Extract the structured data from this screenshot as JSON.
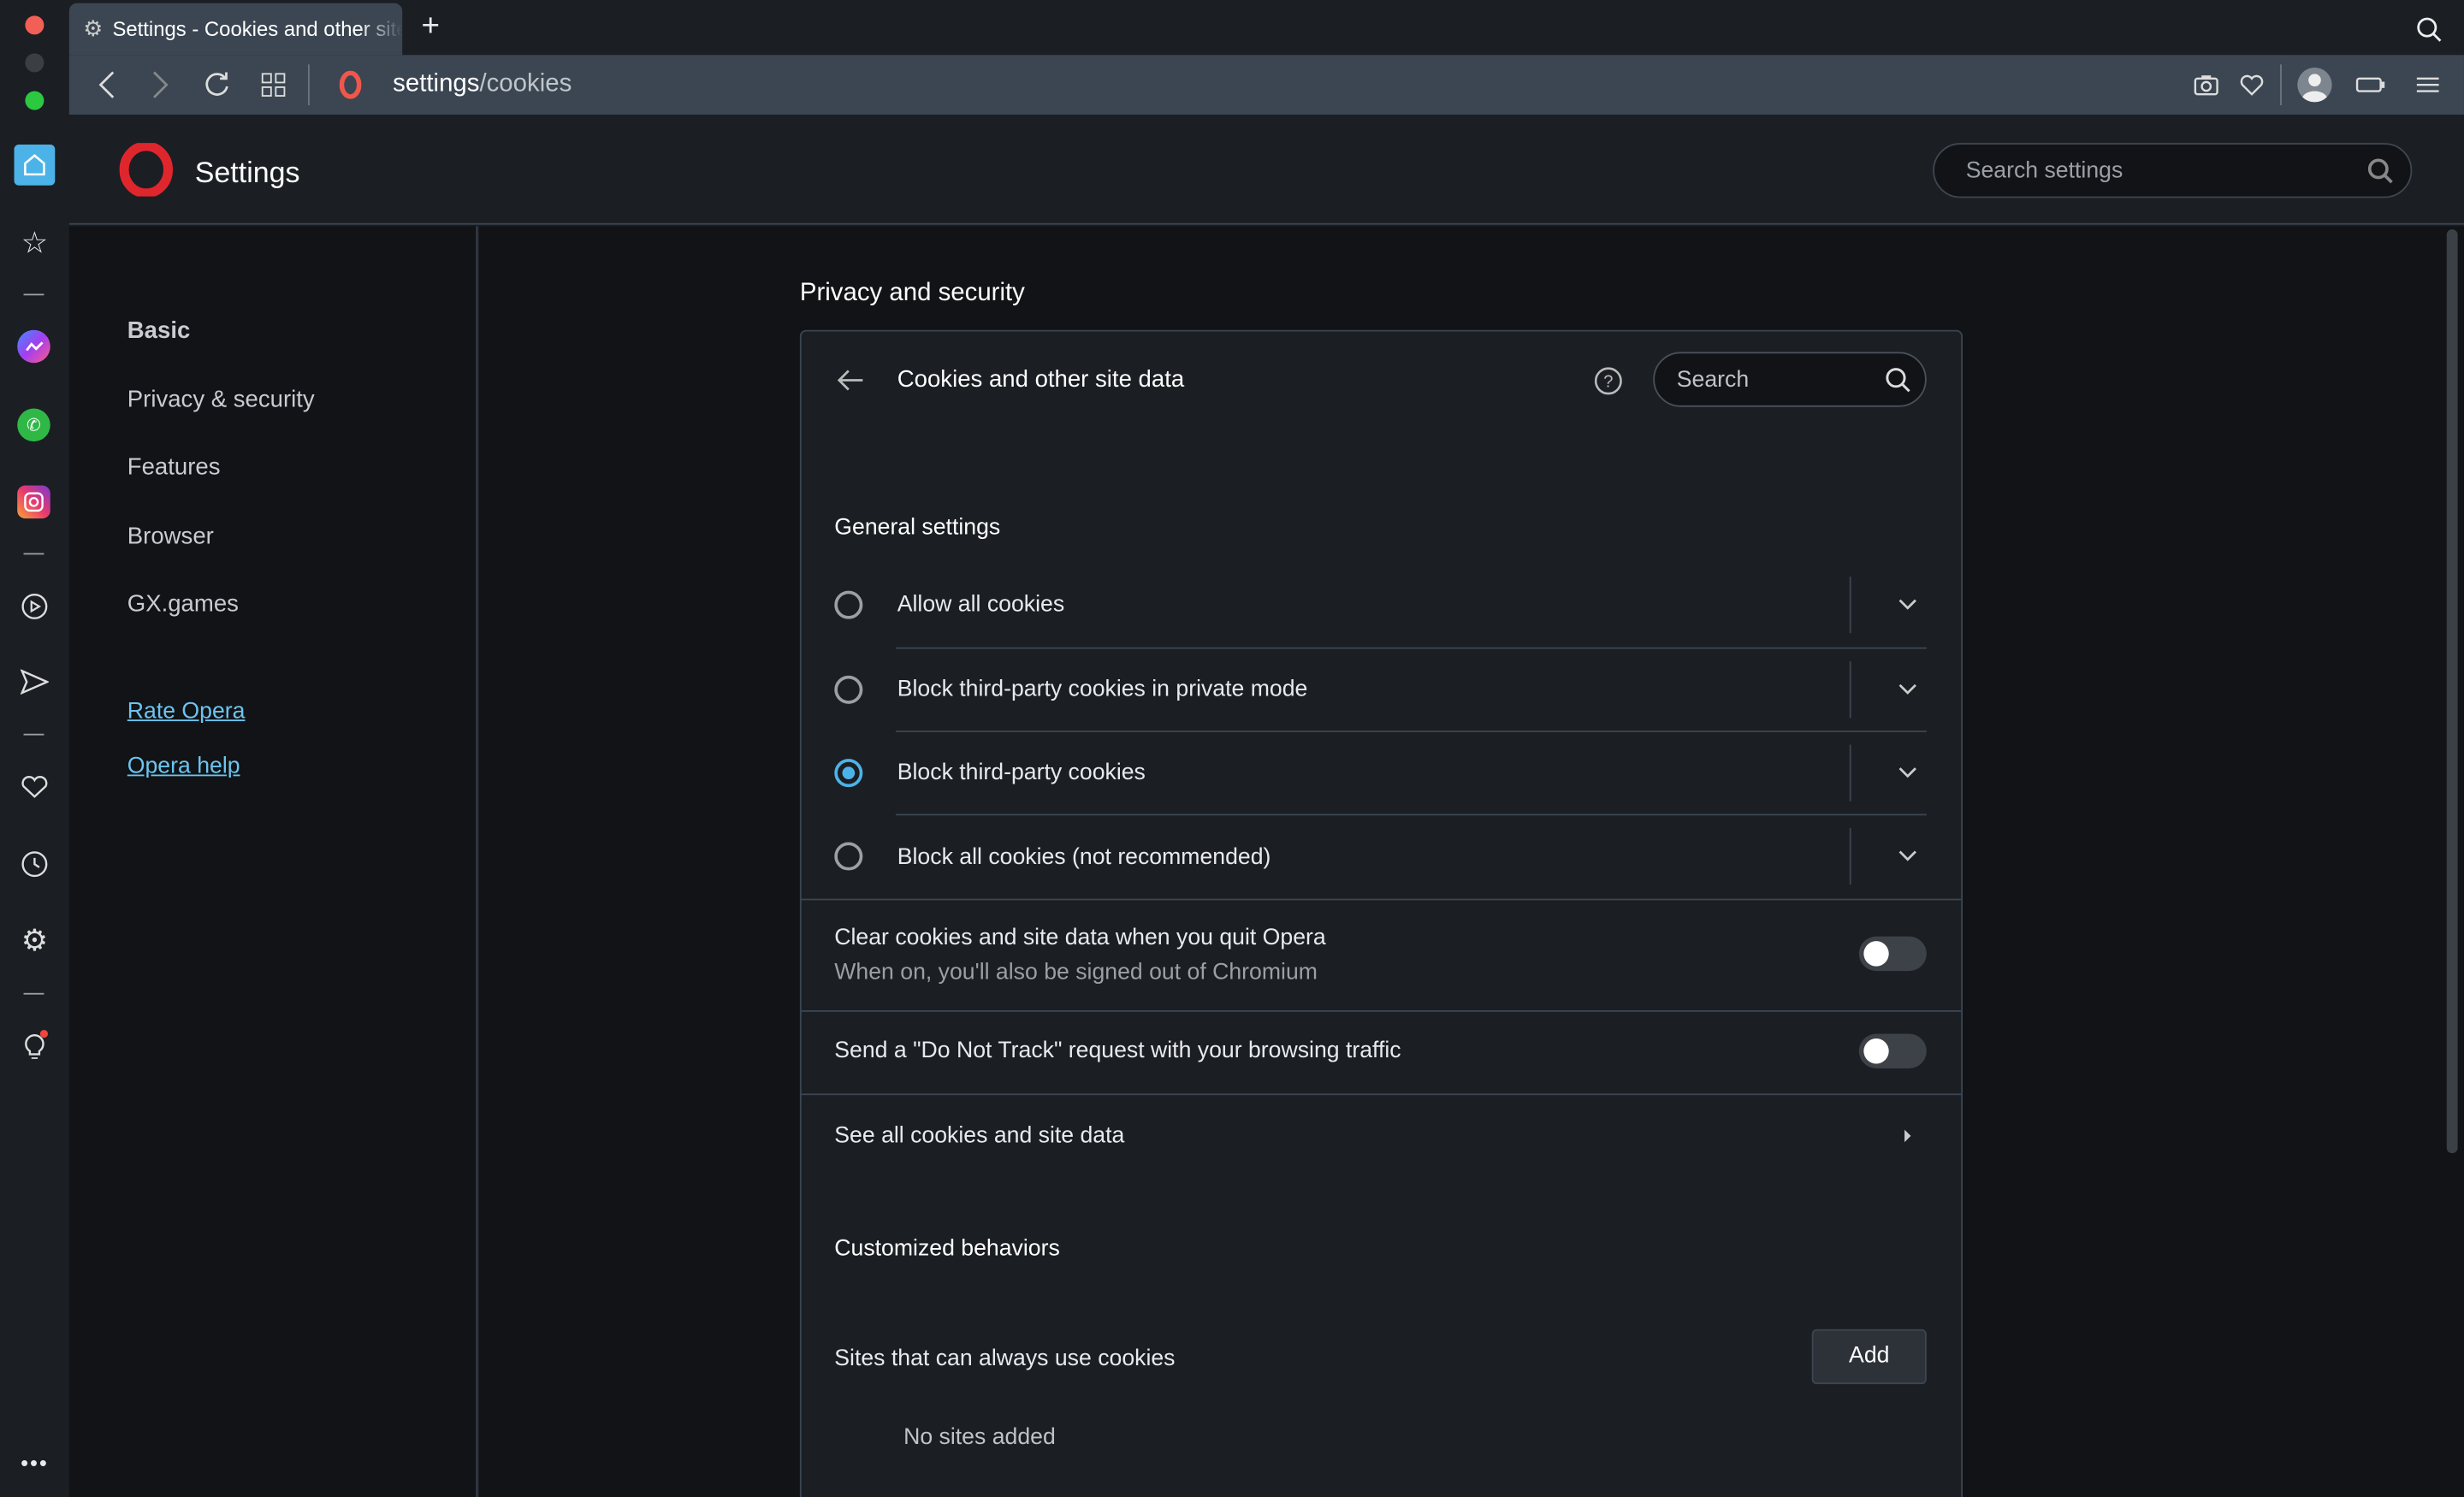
{
  "tab": {
    "title": "Settings - Cookies and other site data"
  },
  "address": {
    "host": "settings",
    "path": "/cookies"
  },
  "header": {
    "title": "Settings",
    "search_placeholder": "Search settings"
  },
  "nav": {
    "items": [
      "Basic",
      "Privacy & security",
      "Features",
      "Browser",
      "GX.games"
    ],
    "links": [
      "Rate Opera",
      "Opera help"
    ]
  },
  "main": {
    "section_title": "Privacy and security",
    "page_title": "Cookies and other site data",
    "search_placeholder": "Search",
    "general_heading": "General settings",
    "options": [
      {
        "label": "Allow all cookies",
        "selected": false
      },
      {
        "label": "Block third-party cookies in private mode",
        "selected": false
      },
      {
        "label": "Block third-party cookies",
        "selected": true
      },
      {
        "label": "Block all cookies (not recommended)",
        "selected": false
      }
    ],
    "clear_on_quit": {
      "label": "Clear cookies and site data when you quit Opera",
      "sub": "When on, you'll also be signed out of Chromium",
      "on": false
    },
    "dnt": {
      "label": "Send a \"Do Not Track\" request with your browsing traffic",
      "on": false
    },
    "see_all": "See all cookies and site data",
    "custom_heading": "Customized behaviors",
    "allow_sites": {
      "label": "Sites that can always use cookies",
      "add": "Add",
      "empty": "No sites added"
    }
  },
  "colors": {
    "accent": "#4cb3e8",
    "link": "#6cc4ef",
    "toolbar": "#3b4652"
  }
}
